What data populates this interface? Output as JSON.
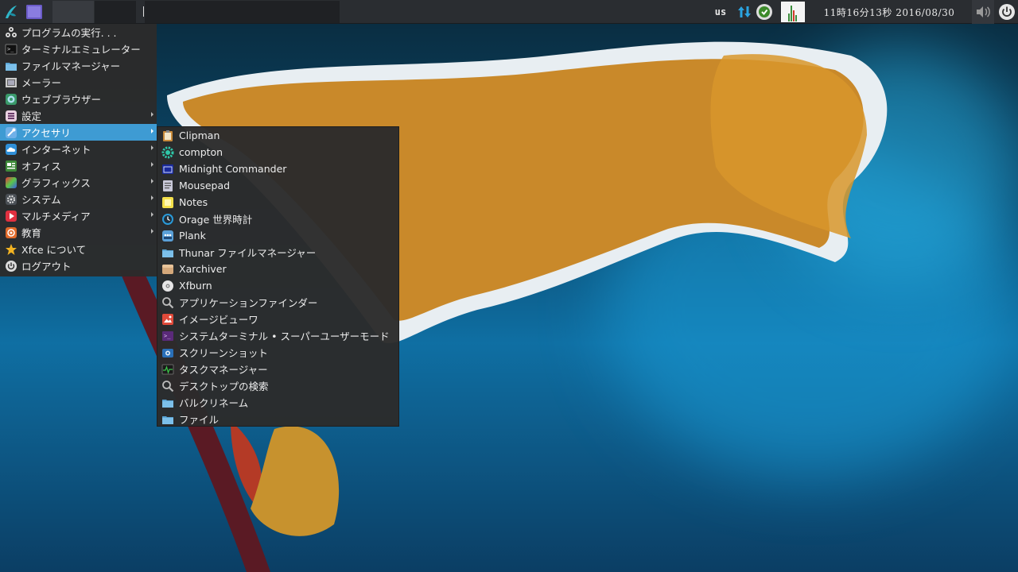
{
  "panel": {
    "keyboard_layout": "us",
    "clock": "11時16分13秒 2016/08/30"
  },
  "main_menu": {
    "items": [
      {
        "label": "プログラムの実行. . .",
        "icon": "run-icon"
      },
      {
        "label": "ターミナルエミュレーター",
        "icon": "terminal-icon"
      },
      {
        "label": "ファイルマネージャー",
        "icon": "folder-icon"
      },
      {
        "label": "メーラー",
        "icon": "mail-icon"
      },
      {
        "label": "ウェブブラウザー",
        "icon": "browser-icon"
      },
      {
        "label": "設定",
        "icon": "settings-icon",
        "submenu": true
      },
      {
        "label": "アクセサリ",
        "icon": "accessories-icon",
        "submenu": true,
        "active": true
      },
      {
        "label": "インターネット",
        "icon": "cloud-icon",
        "submenu": true
      },
      {
        "label": "オフィス",
        "icon": "office-icon",
        "submenu": true
      },
      {
        "label": "グラフィックス",
        "icon": "graphics-icon",
        "submenu": true
      },
      {
        "label": "システム",
        "icon": "system-gear-icon",
        "submenu": true
      },
      {
        "label": "マルチメディア",
        "icon": "multimedia-icon",
        "submenu": true
      },
      {
        "label": "教育",
        "icon": "education-icon",
        "submenu": true
      },
      {
        "label": "Xfce について",
        "icon": "star-icon"
      },
      {
        "label": "ログアウト",
        "icon": "power-icon"
      }
    ]
  },
  "accessories_menu": {
    "items": [
      {
        "label": "Clipman",
        "icon": "clipboard-icon"
      },
      {
        "label": "compton",
        "icon": "compton-gear-icon"
      },
      {
        "label": "Midnight Commander",
        "icon": "midnight-commander-icon"
      },
      {
        "label": "Mousepad",
        "icon": "text-editor-icon"
      },
      {
        "label": "Notes",
        "icon": "notes-icon"
      },
      {
        "label": "Orage 世界時計",
        "icon": "clock-icon"
      },
      {
        "label": "Plank",
        "icon": "plank-icon"
      },
      {
        "label": "Thunar ファイルマネージャー",
        "icon": "folder-icon"
      },
      {
        "label": "Xarchiver",
        "icon": "archive-icon"
      },
      {
        "label": "Xfburn",
        "icon": "disc-icon"
      },
      {
        "label": "アプリケーションファインダー",
        "icon": "search-icon"
      },
      {
        "label": "イメージビューワ",
        "icon": "image-viewer-icon"
      },
      {
        "label": "システムターミナル • スーパーユーザーモード",
        "icon": "root-terminal-icon"
      },
      {
        "label": "スクリーンショット",
        "icon": "screenshot-icon"
      },
      {
        "label": "タスクマネージャー",
        "icon": "task-manager-icon"
      },
      {
        "label": "デスクトップの検索",
        "icon": "search-icon"
      },
      {
        "label": "バルクリネーム",
        "icon": "folder-icon"
      },
      {
        "label": "ファイル",
        "icon": "folder-icon"
      }
    ]
  },
  "colors": {
    "panel_bg": "#2a2d31",
    "menu_bg": "#2b2b2b",
    "menu_highlight": "#3e9bd3"
  }
}
